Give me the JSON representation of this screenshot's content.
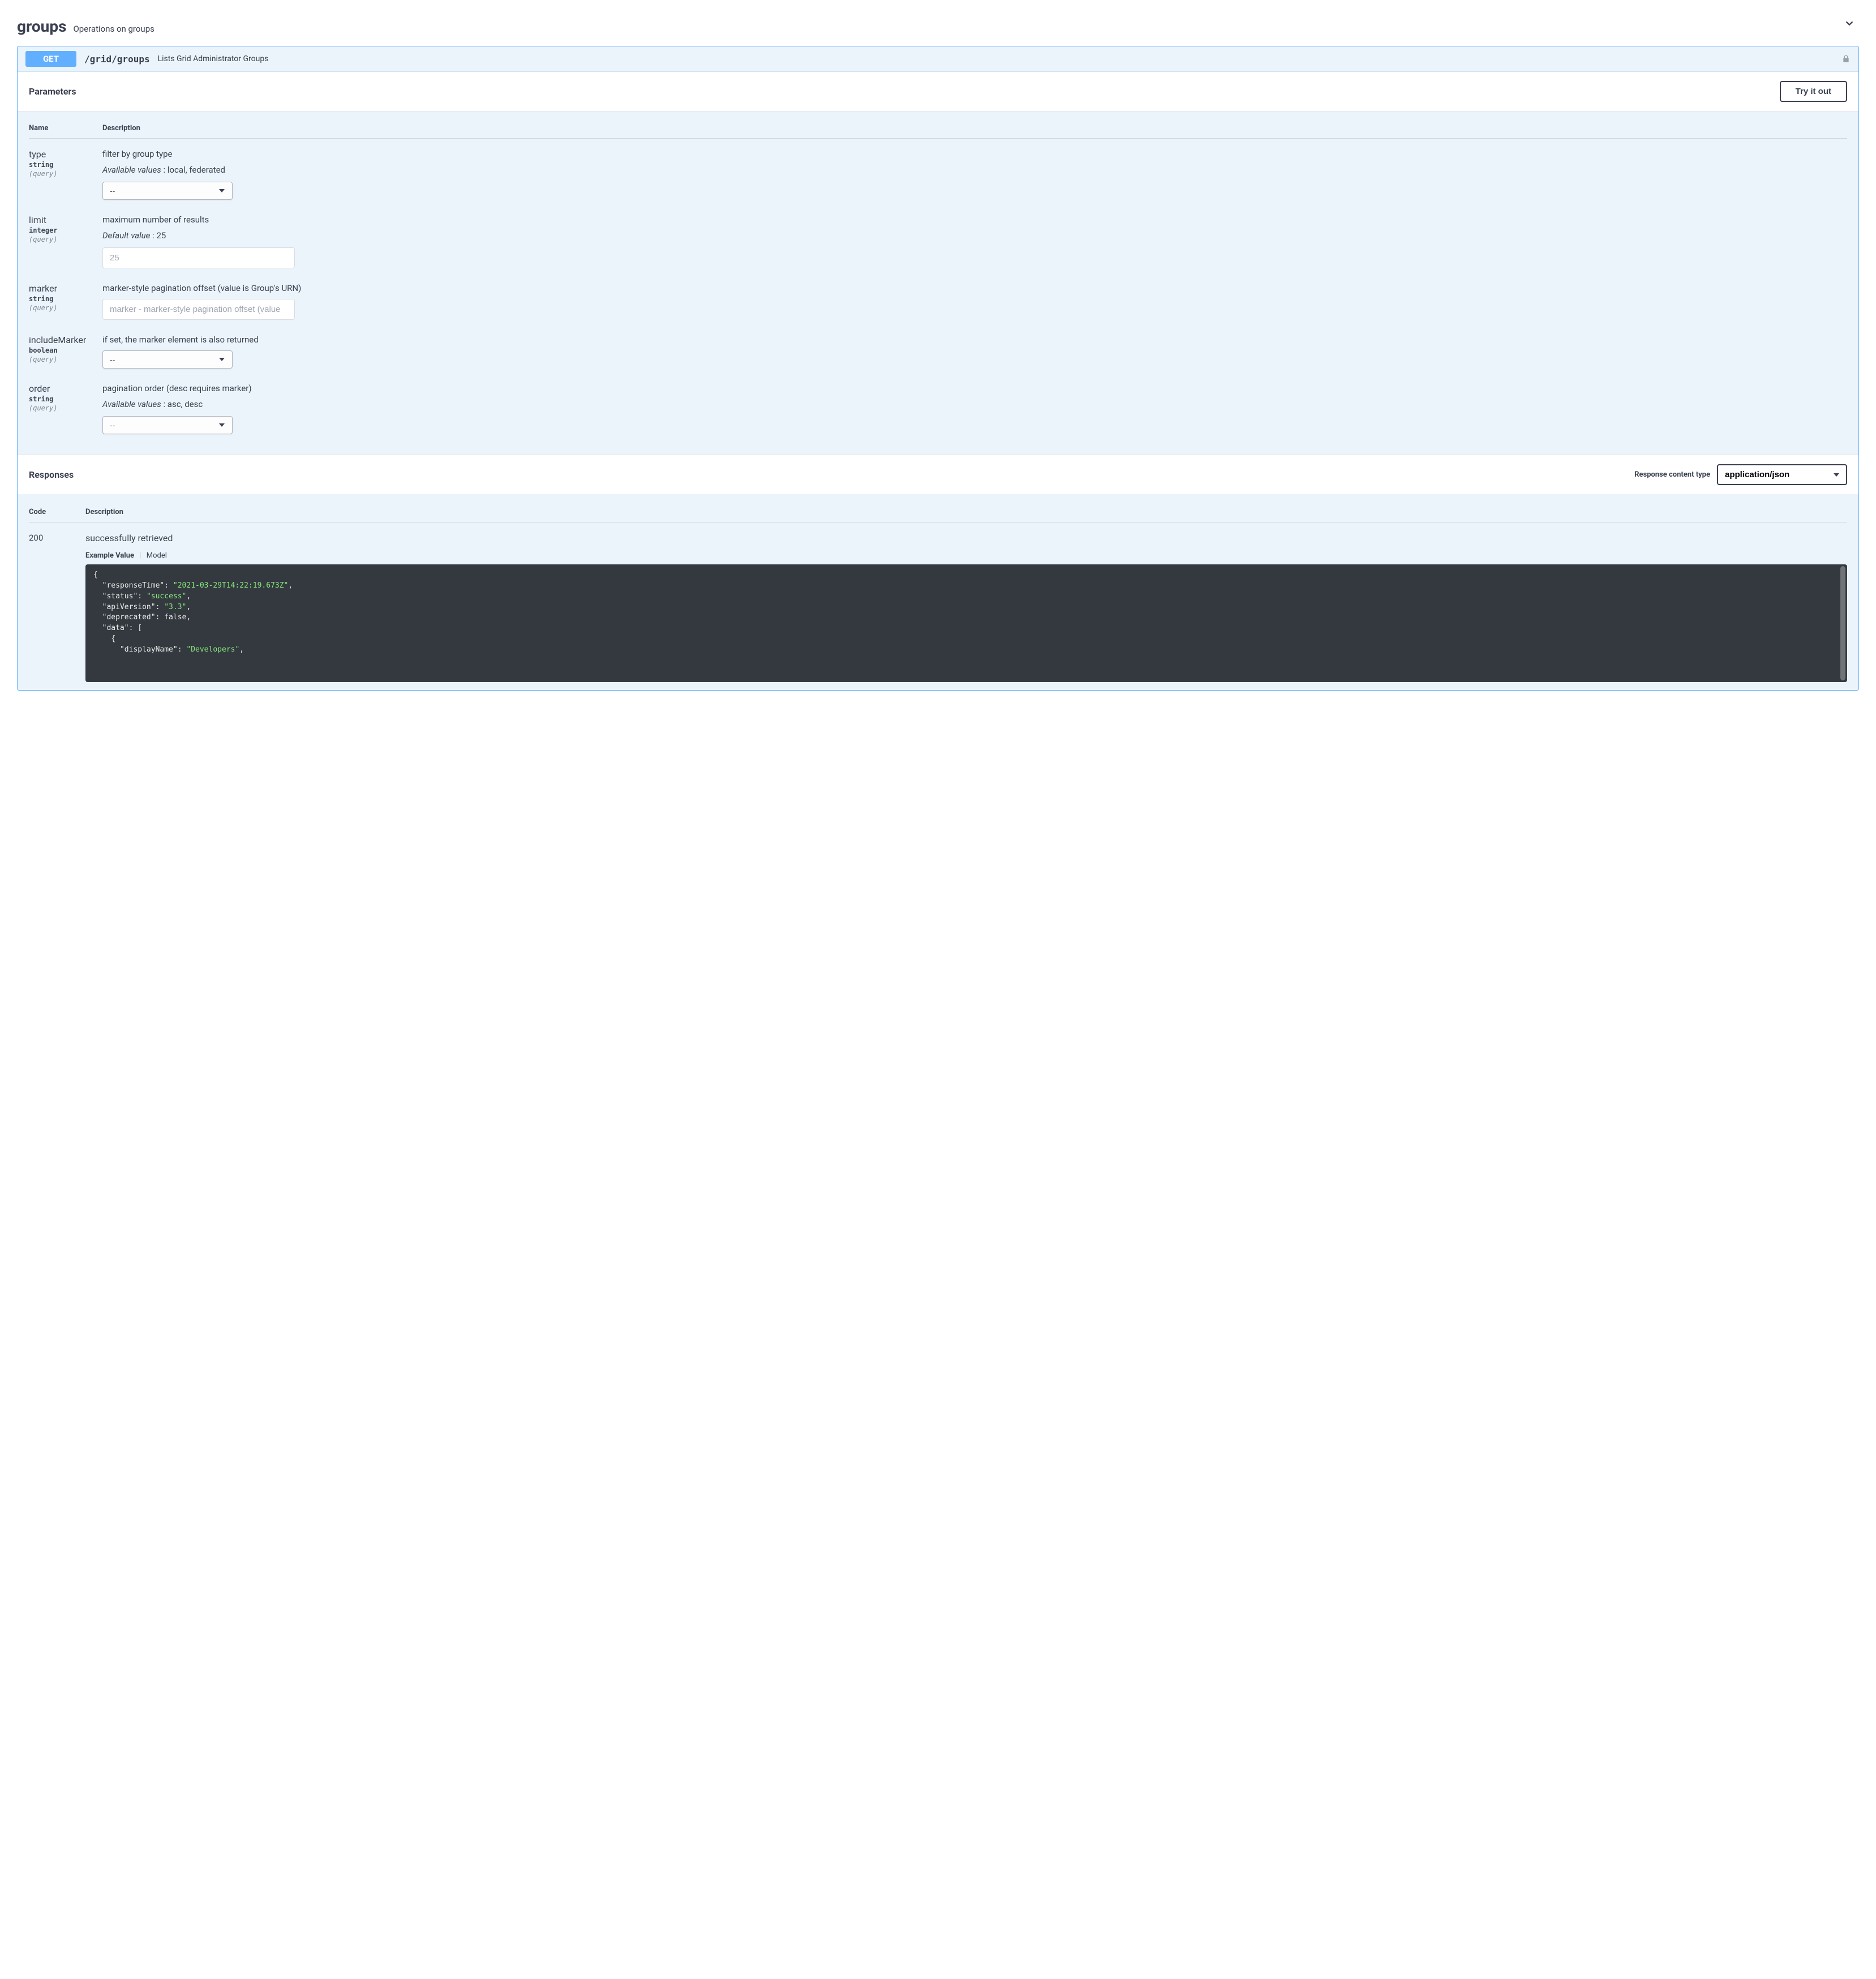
{
  "section": {
    "title": "groups",
    "subtitle": "Operations on groups"
  },
  "op": {
    "method": "GET",
    "path": "/grid/groups",
    "summary": "Lists Grid Administrator Groups"
  },
  "parameters_heading": "Parameters",
  "try_it_out": "Try it out",
  "columns": {
    "name": "Name",
    "description": "Description"
  },
  "params": {
    "type": {
      "name": "type",
      "type": "string",
      "in": "(query)",
      "desc": "filter by group type",
      "available_label": "Available values",
      "available_values": "local, federated",
      "placeholder": "--"
    },
    "limit": {
      "name": "limit",
      "type": "integer",
      "in": "(query)",
      "desc": "maximum number of results",
      "default_label": "Default value",
      "default_value": "25",
      "placeholder": "25"
    },
    "marker": {
      "name": "marker",
      "type": "string",
      "in": "(query)",
      "desc": "marker-style pagination offset (value is Group's URN)",
      "placeholder": "marker - marker-style pagination offset (value"
    },
    "includeMarker": {
      "name": "includeMarker",
      "type": "boolean",
      "in": "(query)",
      "desc": "if set, the marker element is also returned",
      "placeholder": "--"
    },
    "order": {
      "name": "order",
      "type": "string",
      "in": "(query)",
      "desc": "pagination order (desc requires marker)",
      "available_label": "Available values",
      "available_values": "asc, desc",
      "placeholder": "--"
    }
  },
  "responses_heading": "Responses",
  "response_content_type_label": "Response content type",
  "response_content_type": "application/json",
  "resp_columns": {
    "code": "Code",
    "description": "Description"
  },
  "response": {
    "code": "200",
    "desc": "successfully retrieved",
    "tab_example": "Example Value",
    "tab_model": "Model",
    "example": {
      "responseTime": "2021-03-29T14:22:19.673Z",
      "status": "success",
      "apiVersion": "3.3",
      "deprecated": false,
      "data": [
        {
          "displayName": "Developers"
        }
      ]
    }
  }
}
